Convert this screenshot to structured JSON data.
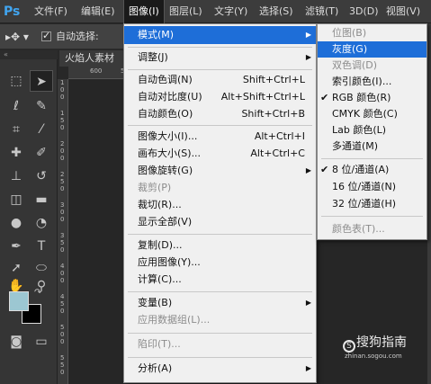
{
  "app": {
    "logo": "Ps"
  },
  "menubar": {
    "items": [
      "文件(F)",
      "编辑(E)",
      "图像(I)",
      "图层(L)",
      "文字(Y)",
      "选择(S)",
      "滤镜(T)",
      "3D(D)",
      "视图(V)"
    ]
  },
  "options": {
    "auto_select_label": "自动选择:"
  },
  "document": {
    "tab_label": "火焰人素材",
    "ruler_h": [
      "600",
      "5"
    ],
    "ruler_v": [
      "1",
      "0",
      "0",
      "1",
      "5",
      "0",
      "2",
      "0",
      "0",
      "2",
      "5",
      "0",
      "3",
      "0",
      "0",
      "3",
      "5",
      "0",
      "4",
      "0",
      "0",
      "4",
      "5",
      "0",
      "5",
      "0",
      "0",
      "5",
      "5",
      "0",
      "6",
      "0",
      "0"
    ]
  },
  "image_menu": {
    "items": [
      {
        "label": "模式(M)",
        "shortcut": "",
        "submenu": true
      },
      {
        "label": "调整(J)",
        "shortcut": "",
        "submenu": true
      },
      {
        "label": "自动色调(N)",
        "shortcut": "Shift+Ctrl+L"
      },
      {
        "label": "自动对比度(U)",
        "shortcut": "Alt+Shift+Ctrl+L"
      },
      {
        "label": "自动颜色(O)",
        "shortcut": "Shift+Ctrl+B"
      },
      {
        "label": "图像大小(I)...",
        "shortcut": "Alt+Ctrl+I"
      },
      {
        "label": "画布大小(S)...",
        "shortcut": "Alt+Ctrl+C"
      },
      {
        "label": "图像旋转(G)",
        "shortcut": "",
        "submenu": true
      },
      {
        "label": "裁剪(P)",
        "shortcut": "",
        "disabled": true
      },
      {
        "label": "裁切(R)...",
        "shortcut": ""
      },
      {
        "label": "显示全部(V)",
        "shortcut": ""
      },
      {
        "label": "复制(D)...",
        "shortcut": ""
      },
      {
        "label": "应用图像(Y)...",
        "shortcut": ""
      },
      {
        "label": "计算(C)...",
        "shortcut": ""
      },
      {
        "label": "变量(B)",
        "shortcut": "",
        "submenu": true
      },
      {
        "label": "应用数据组(L)...",
        "shortcut": "",
        "disabled": true
      },
      {
        "label": "陷印(T)...",
        "shortcut": "",
        "disabled": true
      },
      {
        "label": "分析(A)",
        "shortcut": "",
        "submenu": true
      }
    ]
  },
  "mode_submenu": {
    "items": [
      {
        "label": "位图(B)",
        "disabled": true
      },
      {
        "label": "灰度(G)",
        "highlighted": true
      },
      {
        "label": "双色调(D)",
        "disabled": true
      },
      {
        "label": "索引颜色(I)..."
      },
      {
        "label": "RGB 颜色(R)",
        "checked": true
      },
      {
        "label": "CMYK 颜色(C)"
      },
      {
        "label": "Lab 颜色(L)"
      },
      {
        "label": "多通道(M)"
      },
      {
        "label": "8 位/通道(A)",
        "checked": true
      },
      {
        "label": "16 位/通道(N)"
      },
      {
        "label": "32 位/通道(H)"
      },
      {
        "label": "颜色表(T)...",
        "disabled": true
      }
    ]
  },
  "watermark": {
    "brand": "搜狗指南",
    "url": "zhinan.sogou.com"
  },
  "colors": {
    "fg": "#9cc7d2",
    "bg": "#000000",
    "highlight": "#1e6ed8"
  }
}
